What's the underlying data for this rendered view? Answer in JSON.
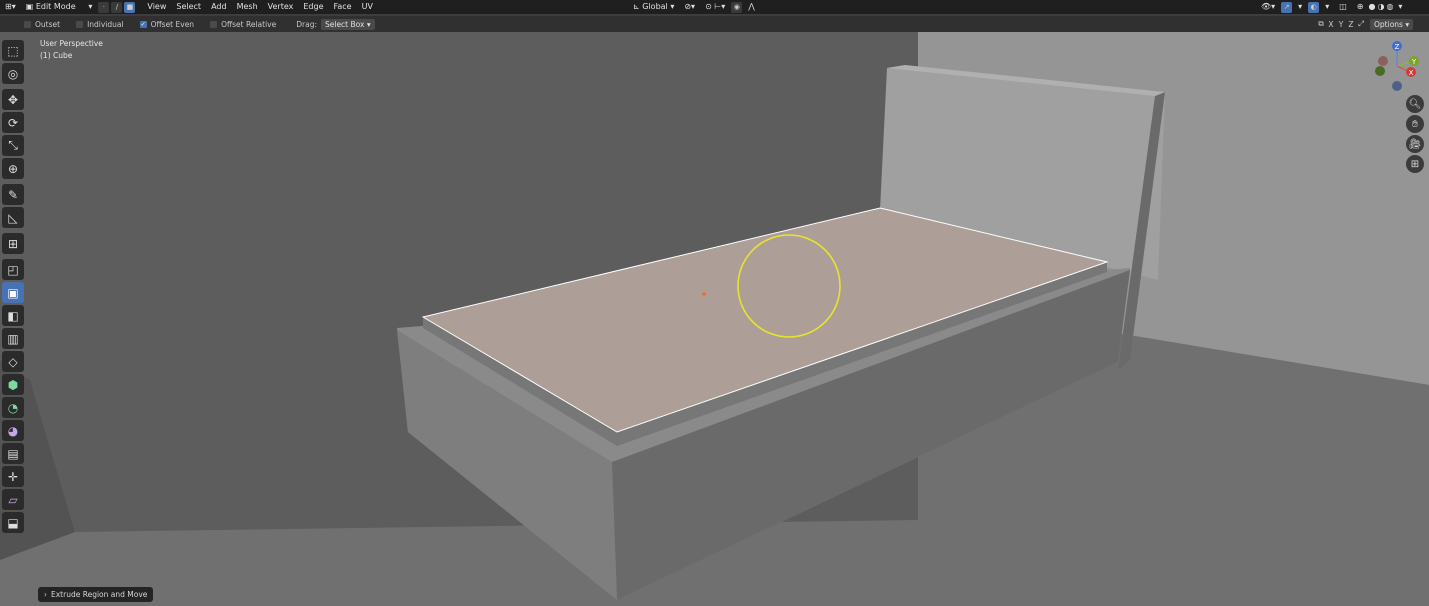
{
  "header": {
    "mode": "Edit Mode",
    "menus": [
      "View",
      "Select",
      "Add",
      "Mesh",
      "Vertex",
      "Edge",
      "Face",
      "UV"
    ],
    "transform_orientation": "Global"
  },
  "tool_settings": {
    "outset": {
      "label": "Outset",
      "checked": false
    },
    "individual": {
      "label": "Individual",
      "checked": false
    },
    "offset_even": {
      "label": "Offset Even",
      "checked": true
    },
    "offset_relative": {
      "label": "Offset Relative",
      "checked": false
    },
    "drag_label": "Drag:",
    "drag_value": "Select Box",
    "axes": [
      "X",
      "Y",
      "Z"
    ],
    "options_label": "Options"
  },
  "viewport": {
    "perspective": "User Perspective",
    "object": "(1) Cube"
  },
  "gizmo": {
    "z": "Z",
    "y": "Y",
    "x": "X"
  },
  "status": {
    "last_operator": "Extrude Region and Move"
  },
  "colors": {
    "accent": "#4772b3",
    "brush_circle": "#e7e32c",
    "selected_face": "#ad9f98"
  },
  "icons": [
    "select-box-icon",
    "cursor-icon",
    "move-icon",
    "rotate-icon",
    "scale-icon",
    "transform-icon",
    "annotate-icon",
    "measure-icon",
    "add-cube-icon",
    "extrude-icon",
    "inset-icon",
    "bevel-icon",
    "loop-cut-icon",
    "knife-icon",
    "poly-build-icon",
    "spin-icon",
    "smooth-icon",
    "edge-slide-icon",
    "shrink-fatten-icon",
    "shear-icon",
    "rip-icon"
  ]
}
